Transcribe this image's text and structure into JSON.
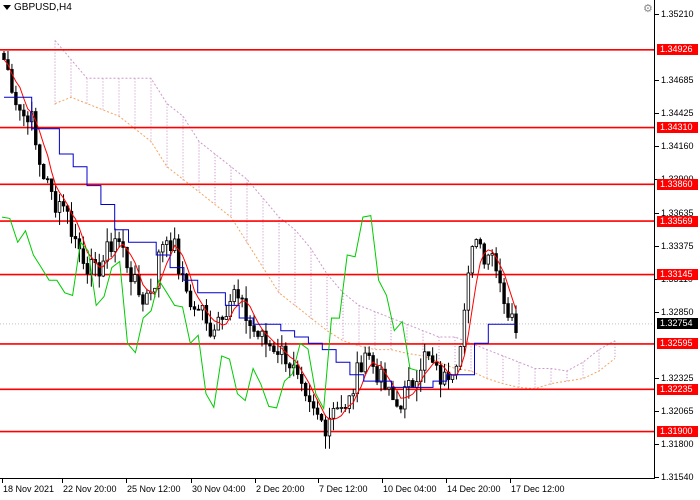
{
  "symbol": "GBPUSD,H4",
  "colors": {
    "level_line": "#ff0000",
    "candle": "#000000",
    "tenkan": "#ff0000",
    "kijun": "#0000cc",
    "chikou": "#00cc00",
    "senkou_a": "#f4a460",
    "senkou_b": "#cc99cc",
    "cloud_fill": "#cc99cc"
  },
  "price_axis": {
    "ticks": [
      "1.35210",
      "1.34685",
      "1.34425",
      "1.34160",
      "1.33900",
      "1.33635",
      "1.33375",
      "1.33110",
      "1.32850",
      "1.32325",
      "1.32065",
      "1.31800",
      "1.31540"
    ]
  },
  "levels": [
    "1.34926",
    "1.34310",
    "1.33860",
    "1.33569",
    "1.33145",
    "1.32595",
    "1.32235",
    "1.31900"
  ],
  "current_price": "1.32754",
  "time_axis": {
    "labels": [
      "18 Nov 2021",
      "22 Nov 20:00",
      "25 Nov 12:00",
      "30 Nov 04:00",
      "2 Dec 20:00",
      "7 Dec 12:00",
      "10 Dec 04:00",
      "14 Dec 20:00",
      "17 Dec 12:00"
    ]
  },
  "chart_data": {
    "type": "candlestick",
    "title": "GBPUSD,H4",
    "ylim": [
      1.3154,
      1.3521
    ],
    "x": [
      "18 Nov 2021",
      "22 Nov 20:00",
      "25 Nov 12:00",
      "30 Nov 04:00",
      "2 Dec 20:00",
      "7 Dec 12:00",
      "10 Dec 04:00",
      "14 Dec 20:00",
      "17 Dec 12:00"
    ],
    "close_path": [
      1.3485,
      1.347,
      1.345,
      1.344,
      1.3445,
      1.341,
      1.3395,
      1.338,
      1.337,
      1.3375,
      1.3355,
      1.334,
      1.333,
      1.332,
      1.3315,
      1.3325,
      1.3335,
      1.3345,
      1.3335,
      1.332,
      1.3305,
      1.3295,
      1.33,
      1.331,
      1.334,
      1.3345,
      1.3335,
      1.331,
      1.33,
      1.3285,
      1.329,
      1.327,
      1.3275,
      1.3285,
      1.329,
      1.33,
      1.329,
      1.328,
      1.327,
      1.3265,
      1.326,
      1.3258,
      1.3255,
      1.325,
      1.324,
      1.3225,
      1.321,
      1.3205,
      1.32,
      1.3195,
      1.321,
      1.3215,
      1.3205,
      1.322,
      1.324,
      1.3255,
      1.3245,
      1.3235,
      1.3225,
      1.3215,
      1.321,
      1.322,
      1.3225,
      1.324,
      1.325,
      1.3245,
      1.3235,
      1.323,
      1.324,
      1.325,
      1.328,
      1.332,
      1.335,
      1.333,
      1.3335,
      1.3325,
      1.33,
      1.328,
      1.3275
    ],
    "kijun": [
      1.3455,
      1.3455,
      1.343,
      1.343,
      1.341,
      1.34,
      1.3385,
      1.337,
      1.335,
      1.334,
      1.334,
      1.333,
      1.332,
      1.331,
      1.33,
      1.33,
      1.329,
      1.328,
      1.3275,
      1.3275,
      1.327,
      1.3265,
      1.326,
      1.3255,
      1.3245,
      1.3235,
      1.323,
      1.323,
      1.3225,
      1.3225,
      1.3225,
      1.323,
      1.3235,
      1.3235,
      1.326,
      1.3275,
      1.3275,
      1.3275
    ],
    "chikou": [
      1.336,
      1.334,
      1.333,
      1.331,
      1.33,
      1.334,
      1.329,
      1.332,
      1.326,
      1.328,
      1.331,
      1.329,
      1.326,
      1.322,
      1.325,
      1.322,
      1.324,
      1.321,
      1.323,
      1.326,
      1.322,
      1.328,
      1.333,
      1.336,
      1.331,
      1.327,
      1.324
    ]
  },
  "header_icons": {
    "settings": "gear-icon"
  }
}
